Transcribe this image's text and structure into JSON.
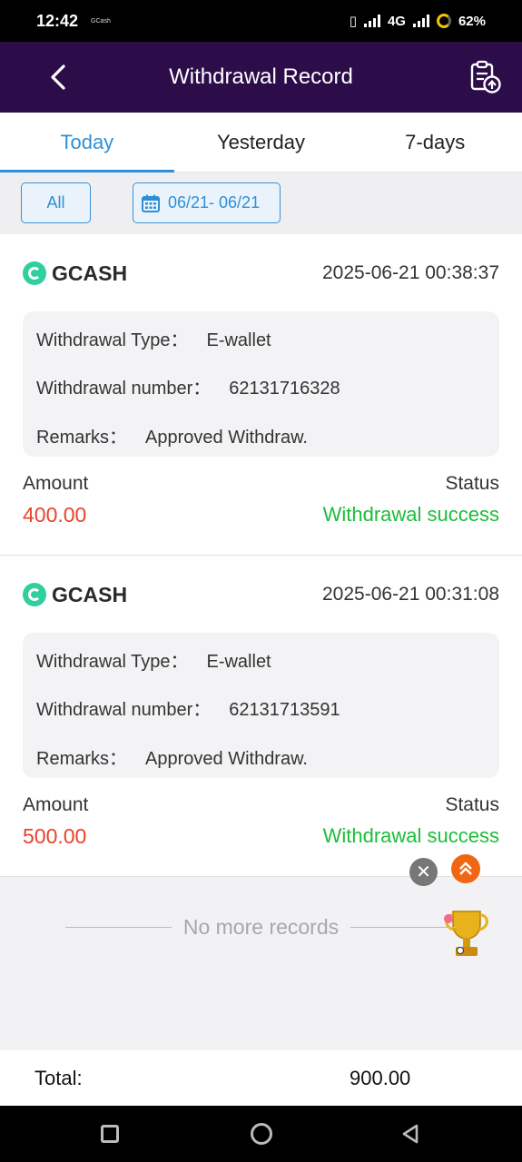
{
  "status_bar": {
    "time": "12:42",
    "app_label": "GCash",
    "network": "4G",
    "battery": "62%"
  },
  "header": {
    "title": "Withdrawal Record"
  },
  "tabs": [
    {
      "label": "Today",
      "active": true
    },
    {
      "label": "Yesterday",
      "active": false
    },
    {
      "label": "7-days",
      "active": false
    }
  ],
  "filters": {
    "all_label": "All",
    "date_range": "06/21- 06/21"
  },
  "records": [
    {
      "provider": "GCASH",
      "datetime": "2025-06-21 00:38:37",
      "type_label": "Withdrawal Type：",
      "type_value": "E-wallet",
      "number_label": "Withdrawal number：",
      "number_value": "62131716328",
      "remarks_label": "Remarks：",
      "remarks_value": "Approved Withdraw.",
      "amount_label": "Amount",
      "amount_value": "400.00",
      "status_label": "Status",
      "status_value": "Withdrawal success"
    },
    {
      "provider": "GCASH",
      "datetime": "2025-06-21 00:31:08",
      "type_label": "Withdrawal Type：",
      "type_value": "E-wallet",
      "number_label": "Withdrawal number：",
      "number_value": "62131713591",
      "remarks_label": "Remarks：",
      "remarks_value": "Approved Withdraw.",
      "amount_label": "Amount",
      "amount_value": "500.00",
      "status_label": "Status",
      "status_value": "Withdrawal success"
    }
  ],
  "end_message": "No more records",
  "total": {
    "label": "Total:",
    "value": "900.00"
  },
  "colors": {
    "header_bg": "#2c0d4a",
    "accent_blue": "#2f8fd6",
    "amount_red": "#e8432b",
    "success_green": "#1cbd3a",
    "gcash_green": "#2fcf9e"
  }
}
